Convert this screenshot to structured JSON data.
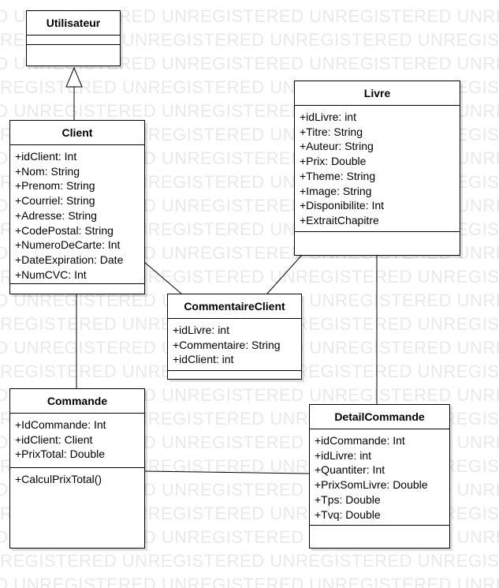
{
  "watermark": {
    "text": "UNREGISTERED"
  },
  "classes": {
    "utilisateur": {
      "name": "Utilisateur",
      "attributes": [],
      "operations": []
    },
    "client": {
      "name": "Client",
      "attributes": [
        "+idClient: Int",
        "+Nom: String",
        "+Prenom: String",
        "+Courriel: String",
        "+Adresse: String",
        "+CodePostal: String",
        "+NumeroDeCarte: Int",
        "+DateExpiration: Date",
        "+NumCVC: Int"
      ],
      "operations": []
    },
    "livre": {
      "name": "Livre",
      "attributes": [
        "+idLivre: int",
        "+Titre: String",
        "+Auteur: String",
        "+Prix: Double",
        "+Theme: String",
        "+Image: String",
        "+Disponibilite: Int",
        "+ExtraitChapitre"
      ],
      "operations": []
    },
    "commentaire_client": {
      "name": "CommentaireClient",
      "attributes": [
        "+idLivre: int",
        "+Commentaire: String",
        "+idClient: int"
      ],
      "operations": []
    },
    "commande": {
      "name": "Commande",
      "attributes": [
        "+IdCommande: Int",
        "+idClient: Client",
        "+PrixTotal: Double"
      ],
      "operations": [
        "+CalculPrixTotal()"
      ]
    },
    "detail_commande": {
      "name": "DetailCommande",
      "attributes": [
        "+idCommande: Int",
        "+idLivre: int",
        "+Quantiter: Int",
        "+PrixSomLivre: Double",
        "+Tps: Double",
        "+Tvq: Double"
      ],
      "operations": []
    }
  },
  "relationships": [
    {
      "type": "generalization",
      "from": "client",
      "to": "utilisateur"
    },
    {
      "type": "association",
      "from": "client",
      "to": "commentaire_client"
    },
    {
      "type": "association",
      "from": "livre",
      "to": "commentaire_client"
    },
    {
      "type": "association",
      "from": "client",
      "to": "commande"
    },
    {
      "type": "association",
      "from": "livre",
      "to": "detail_commande"
    },
    {
      "type": "association",
      "from": "commande",
      "to": "detail_commande"
    }
  ]
}
